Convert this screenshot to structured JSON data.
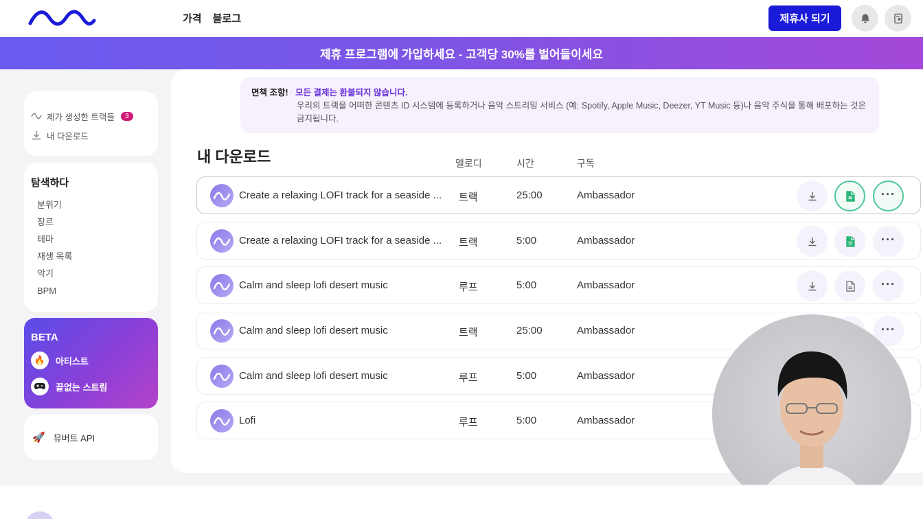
{
  "header": {
    "nav": [
      "가격",
      "블로그"
    ],
    "affiliate_button": "제휴사 되기"
  },
  "banner": {
    "text": "제휴 프로그램에 가입하세요 - 고객당 30%를 벌어들이세요"
  },
  "sidebar": {
    "my_tracks": {
      "label": "제가 생성한 트랙들",
      "count": "3"
    },
    "my_downloads": "내 다운로드",
    "explore": {
      "title": "탐색하다",
      "items": [
        "분위기",
        "장르",
        "테마",
        "재생 목록",
        "악기",
        "BPM"
      ]
    },
    "beta": {
      "title": "BETA",
      "items": [
        "아티스트",
        "끝없는 스트림"
      ]
    },
    "api": "뮤버트 API"
  },
  "disclaimer": {
    "label": "면책 조항!",
    "highlight": "모든 결제는 환불되지 않습니다.",
    "body": "우리의 트랙을 어떠한 콘텐츠 ID 시스템에 등록하거나 음악 스트리밍 서비스 (예: Spotify, Apple Music, Deezer, YT Music 등)나 음악 주식을 통해 배포하는 것은 금지됩니다."
  },
  "downloads": {
    "title": "내 다운로드",
    "columns": [
      "멜로디",
      "시간",
      "구독"
    ],
    "rows": [
      {
        "name": "Create a relaxing LOFI track for a seaside ...",
        "kind": "트랙",
        "duration": "25:00",
        "subscription": "Ambassador"
      },
      {
        "name": "Create a relaxing LOFI track for a seaside ...",
        "kind": "트랙",
        "duration": "5:00",
        "subscription": "Ambassador"
      },
      {
        "name": "Calm and sleep lofi desert music",
        "kind": "루프",
        "duration": "5:00",
        "subscription": "Ambassador"
      },
      {
        "name": "Calm and sleep lofi desert music",
        "kind": "트랙",
        "duration": "25:00",
        "subscription": "Ambassador"
      },
      {
        "name": "Calm and sleep lofi desert music",
        "kind": "루프",
        "duration": "5:00",
        "subscription": "Ambassador"
      },
      {
        "name": "Lofi",
        "kind": "루프",
        "duration": "5:00",
        "subscription": "Ambassador"
      }
    ]
  },
  "icons": {
    "logo": "wave-logo",
    "bell": "bell-icon",
    "profile": "document-user-icon",
    "download": "download-icon",
    "file": "file-icon",
    "more": "more-icon"
  },
  "colors": {
    "accent": "#1a1ad9",
    "badge": "#d01a78",
    "file_green": "#2db67a",
    "highlight_purple": "#6a33d8"
  }
}
